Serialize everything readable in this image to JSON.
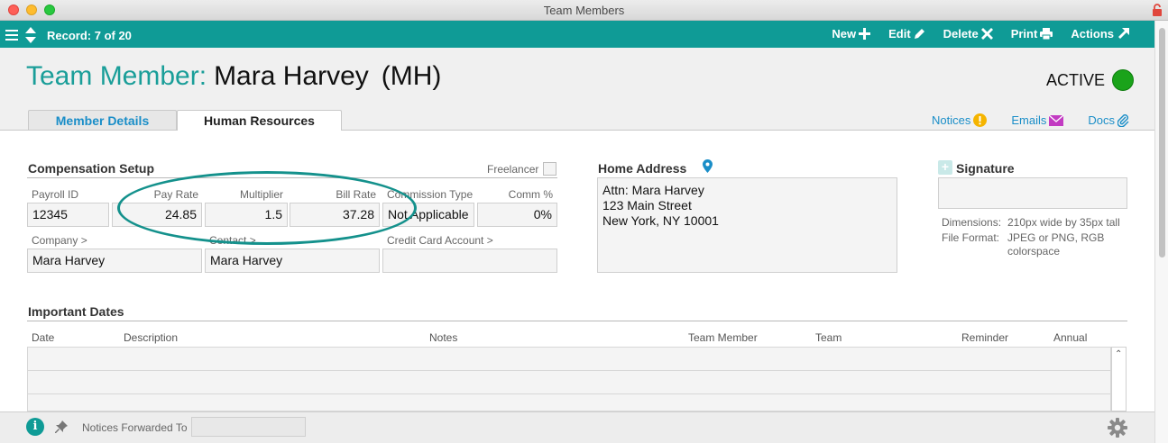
{
  "window": {
    "title": "Team Members"
  },
  "toolbar": {
    "record": "Record: 7 of 20",
    "buttons": {
      "new": "New",
      "edit": "Edit",
      "delete": "Delete",
      "print": "Print",
      "actions": "Actions"
    }
  },
  "header": {
    "title_prefix": "Team Member:",
    "name": "Mara Harvey",
    "initials": "(MH)",
    "status": "ACTIVE",
    "status_color": "#1aa31a"
  },
  "tabs": [
    {
      "label": "Member Details",
      "active": false
    },
    {
      "label": "Human Resources",
      "active": true
    }
  ],
  "links": {
    "notices": "Notices",
    "emails": "Emails",
    "docs": "Docs"
  },
  "compensation": {
    "title": "Compensation Setup",
    "freelancer_label": "Freelancer",
    "freelancer_checked": false,
    "payroll_id": {
      "label": "Payroll ID",
      "value": "12345"
    },
    "pay_rate": {
      "label": "Pay Rate",
      "value": "24.85"
    },
    "multiplier": {
      "label": "Multiplier",
      "value": "1.5"
    },
    "bill_rate": {
      "label": "Bill Rate",
      "value": "37.28"
    },
    "commission_type": {
      "label": "Commission Type",
      "value": "Not Applicable"
    },
    "comm_pct": {
      "label": "Comm %",
      "value": "0%"
    },
    "company": {
      "label": "Company >",
      "value": "Mara Harvey"
    },
    "contact": {
      "label": "Contact >",
      "value": "Mara Harvey"
    },
    "credit_card": {
      "label": "Credit Card Account >",
      "value": ""
    }
  },
  "home_address": {
    "title": "Home Address",
    "lines": [
      "Attn: Mara Harvey",
      "123 Main Street",
      "New York, NY 10001"
    ]
  },
  "signature": {
    "title": "Signature",
    "dimensions_label": "Dimensions:",
    "dimensions_value": "210px wide by 35px tall",
    "format_label": "File Format:",
    "format_value": "JPEG or PNG, RGB colorspace"
  },
  "important_dates": {
    "title": "Important Dates",
    "columns": [
      "Date",
      "Description",
      "Notes",
      "Team Member",
      "Team",
      "Reminder",
      "Annual"
    ]
  },
  "footer": {
    "notices_forwarded_label": "Notices Forwarded To",
    "notices_forwarded_value": ""
  },
  "colors": {
    "accent": "#0f9b96",
    "link": "#1a8ec8",
    "title_teal": "#1a9e99"
  }
}
